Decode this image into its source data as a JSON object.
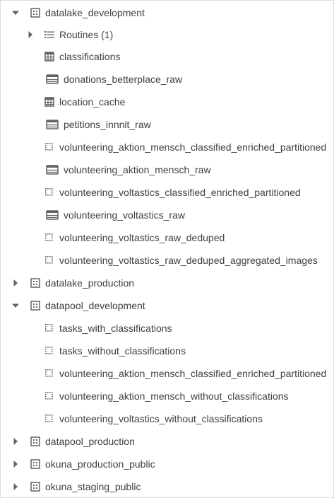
{
  "tree": {
    "nodes": [
      {
        "id": "datalake_development",
        "label": "datalake_development",
        "kind": "dataset",
        "expanded": true
      },
      {
        "id": "routines",
        "label": "Routines (1)",
        "kind": "routines",
        "expanded": false
      },
      {
        "id": "classifications",
        "label": "classifications",
        "kind": "table"
      },
      {
        "id": "donations_betterplace_raw",
        "label": "donations_betterplace_raw",
        "kind": "external-table"
      },
      {
        "id": "location_cache",
        "label": "location_cache",
        "kind": "table"
      },
      {
        "id": "petitions_innnit_raw",
        "label": "petitions_innnit_raw",
        "kind": "external-table"
      },
      {
        "id": "vam_classified_1",
        "label": "volunteering_aktion_mensch_classified_enriched_partitioned",
        "kind": "view"
      },
      {
        "id": "vam_raw",
        "label": "volunteering_aktion_mensch_raw",
        "kind": "external-table"
      },
      {
        "id": "vv_classified",
        "label": "volunteering_voltastics_classified_enriched_partitioned",
        "kind": "view"
      },
      {
        "id": "vv_raw",
        "label": "volunteering_voltastics_raw",
        "kind": "external-table"
      },
      {
        "id": "vv_raw_deduped",
        "label": "volunteering_voltastics_raw_deduped",
        "kind": "view"
      },
      {
        "id": "vv_raw_deduped_agg",
        "label": "volunteering_voltastics_raw_deduped_aggregated_images",
        "kind": "view"
      },
      {
        "id": "datalake_production",
        "label": "datalake_production",
        "kind": "dataset",
        "expanded": false
      },
      {
        "id": "datapool_development",
        "label": "datapool_development",
        "kind": "dataset",
        "expanded": true
      },
      {
        "id": "tasks_with",
        "label": "tasks_with_classifications",
        "kind": "view"
      },
      {
        "id": "tasks_without",
        "label": "tasks_without_classifications",
        "kind": "view"
      },
      {
        "id": "vam_classified_2",
        "label": "volunteering_aktion_mensch_classified_enriched_partitioned",
        "kind": "view"
      },
      {
        "id": "vam_without",
        "label": "volunteering_aktion_mensch_without_classifications",
        "kind": "view"
      },
      {
        "id": "vv_without",
        "label": "volunteering_voltastics_without_classifications",
        "kind": "view"
      },
      {
        "id": "datapool_production",
        "label": "datapool_production",
        "kind": "dataset",
        "expanded": false
      },
      {
        "id": "okuna_production_public",
        "label": "okuna_production_public",
        "kind": "dataset",
        "expanded": false
      },
      {
        "id": "okuna_staging_public",
        "label": "okuna_staging_public",
        "kind": "dataset",
        "expanded": false
      }
    ]
  },
  "icons": {
    "expanded": "caret-down-icon",
    "collapsed": "caret-right-icon",
    "dataset": "dataset-icon",
    "routines": "routines-icon",
    "table": "table-icon",
    "external-table": "external-table-icon",
    "view": "view-icon"
  },
  "colors": {
    "icon": "#5f6368",
    "text": "#3c4043",
    "border": "#dadce0"
  }
}
